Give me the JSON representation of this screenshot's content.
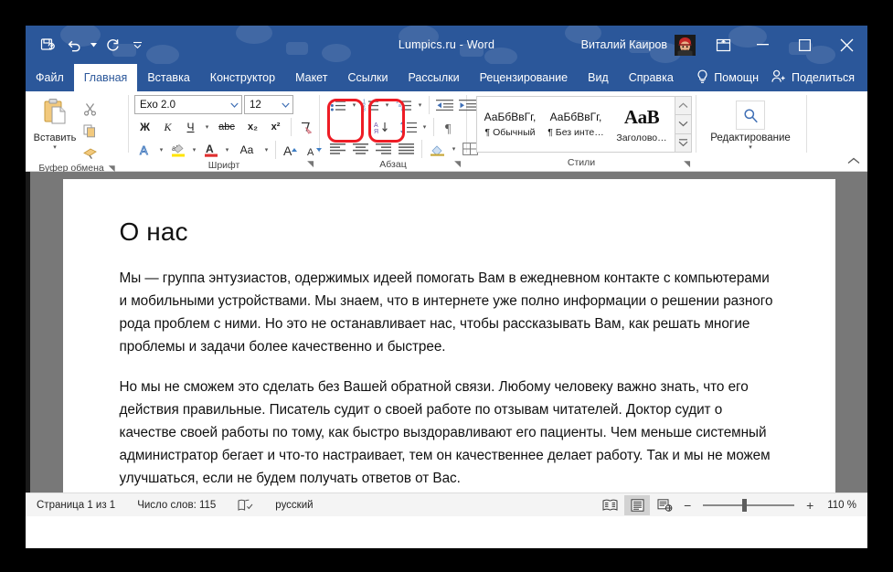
{
  "titlebar": {
    "document_title": "Lumpics.ru  -  Word",
    "user_name": "Виталий Каиров",
    "qat": [
      {
        "name": "save-icon",
        "label": "Сохранить"
      },
      {
        "name": "undo-icon",
        "label": "Отменить"
      },
      {
        "name": "redo-icon",
        "label": "Вернуть"
      },
      {
        "name": "customize-qat-icon",
        "label": "Настройка панели быстрого доступа"
      }
    ],
    "ribbon_display_options": "Параметры отображения ленты",
    "minimize": "Свернуть",
    "maximize": "Развернуть",
    "close": "Закрыть"
  },
  "tabs": [
    {
      "label": "Файл",
      "active": false
    },
    {
      "label": "Главная",
      "active": true
    },
    {
      "label": "Вставка",
      "active": false
    },
    {
      "label": "Конструктор",
      "active": false
    },
    {
      "label": "Макет",
      "active": false
    },
    {
      "label": "Ссылки",
      "active": false
    },
    {
      "label": "Рассылки",
      "active": false
    },
    {
      "label": "Рецензирование",
      "active": false
    },
    {
      "label": "Вид",
      "active": false
    },
    {
      "label": "Справка",
      "active": false
    }
  ],
  "tellme": {
    "label": "Помощн"
  },
  "share": {
    "label": "Поделиться"
  },
  "ribbon": {
    "clipboard": {
      "group_label": "Буфер обмена",
      "paste_label": "Вставить",
      "cut_label": "Вырезать",
      "copy_label": "Копировать",
      "format_painter_label": "Формат по образцу"
    },
    "font": {
      "group_label": "Шрифт",
      "font_name": "Exo 2.0",
      "font_size": "12",
      "bold": "Ж",
      "italic": "К",
      "underline": "Ч",
      "strikethrough": "abc",
      "subscript": "x₂",
      "superscript": "x²",
      "clear_formatting": "Очистить формат",
      "text_effects": "A",
      "text_highlight": "Цвет выделения текста",
      "font_color": "Цвет шрифта",
      "change_case": "Aa",
      "grow_font": "A",
      "shrink_font": "A"
    },
    "paragraph": {
      "group_label": "Абзац",
      "bullets": "Маркеры",
      "numbering": "Нумерация",
      "multilevel": "Многоуровневый список",
      "decrease_indent": "Уменьшить отступ",
      "increase_indent": "Увеличить отступ",
      "sort": "Сортировка",
      "show_marks": "¶",
      "align_left": "По левому краю",
      "align_center": "По центру",
      "align_right": "По правому краю",
      "justify": "По ширине",
      "line_spacing": "Интервал",
      "shading": "Заливка",
      "borders": "Границы",
      "highlighted_buttons": [
        "align-left",
        "align-center"
      ],
      "highlight_color": "#ee1c25"
    },
    "styles": {
      "group_label": "Стили",
      "items": [
        {
          "preview": "АаБбВвГг,",
          "name": "¶ Обычный",
          "kind": "body"
        },
        {
          "preview": "АаБбВвГг,",
          "name": "¶ Без инте…",
          "kind": "body"
        },
        {
          "preview": "AaB",
          "name": "Заголово…",
          "kind": "heading"
        }
      ]
    },
    "editing": {
      "group_label": "",
      "label": "Редактирование",
      "icon": "search-icon"
    }
  },
  "document": {
    "heading": "О нас",
    "paragraphs": [
      "Мы — группа энтузиастов, одержимых идеей помогать Вам в ежедневном контакте с компьютерами и мобильными устройствами. Мы знаем, что в интернете уже полно информации о решении разного рода проблем с ними. Но это не останавливает нас, чтобы рассказывать Вам, как решать многие проблемы и задачи более качественно и быстрее.",
      "Но мы не сможем это сделать без Вашей обратной связи. Любому человеку важно знать, что его действия правильные. Писатель судит о своей работе по отзывам читателей. Доктор судит о качестве своей работы по тому, как быстро выздоравливают его пациенты. Чем меньше системный администратор бегает и что-то настраивает, тем он качественнее делает работу. Так и мы не можем улучшаться, если не будем получать ответов от Вас."
    ]
  },
  "statusbar": {
    "page": "Страница 1 из 1",
    "words": "Число слов: 115",
    "proofing_icon": "proofing-icon",
    "language": "русский",
    "views": [
      {
        "name": "read-mode-view",
        "active": false
      },
      {
        "name": "print-layout-view",
        "active": true
      },
      {
        "name": "web-layout-view",
        "active": false
      }
    ],
    "zoom_out": "−",
    "zoom_in": "+",
    "zoom_value": "110 %"
  }
}
